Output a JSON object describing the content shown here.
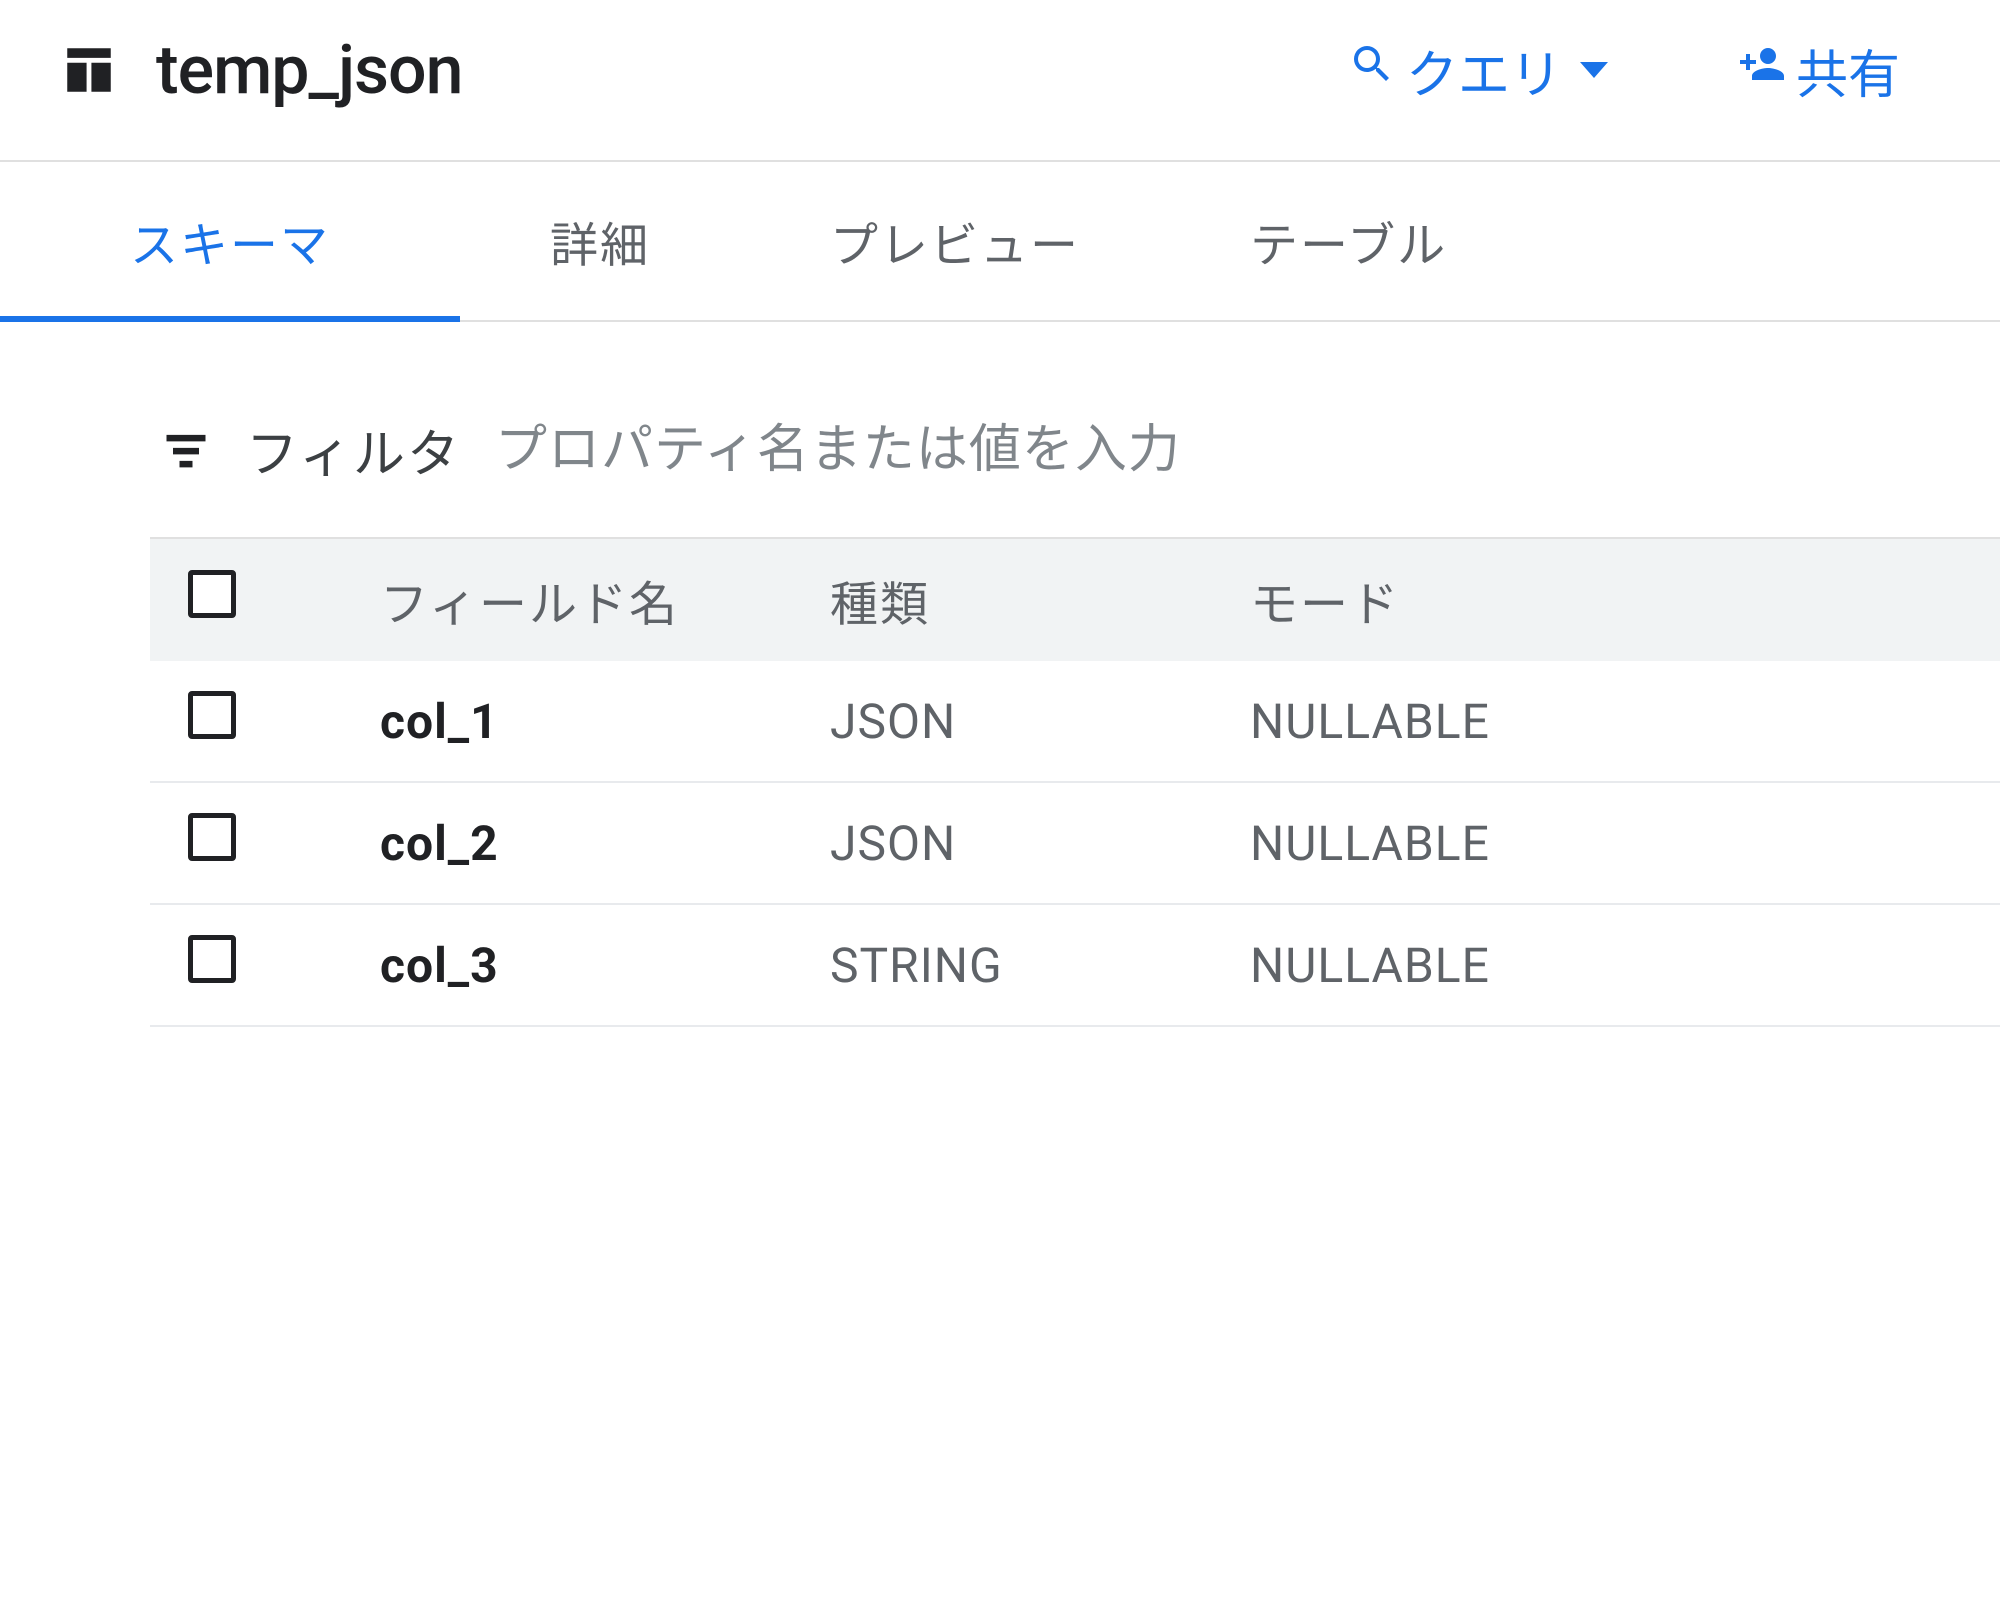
{
  "header": {
    "title": "temp_json",
    "actions": {
      "query_label": "クエリ",
      "share_label": "共有"
    }
  },
  "tabs": [
    {
      "id": "schema",
      "label": "スキーマ",
      "active": true
    },
    {
      "id": "details",
      "label": "詳細",
      "active": false
    },
    {
      "id": "preview",
      "label": "プレビュー",
      "active": false
    },
    {
      "id": "table",
      "label": "テーブル",
      "active": false
    }
  ],
  "filter": {
    "label": "フィルタ",
    "placeholder": "プロパティ名または値を入力"
  },
  "schema": {
    "columns": {
      "field_name": "フィールド名",
      "type": "種類",
      "mode": "モード"
    },
    "rows": [
      {
        "name": "col_1",
        "type": "JSON",
        "mode": "NULLABLE"
      },
      {
        "name": "col_2",
        "type": "JSON",
        "mode": "NULLABLE"
      },
      {
        "name": "col_3",
        "type": "STRING",
        "mode": "NULLABLE"
      }
    ]
  }
}
